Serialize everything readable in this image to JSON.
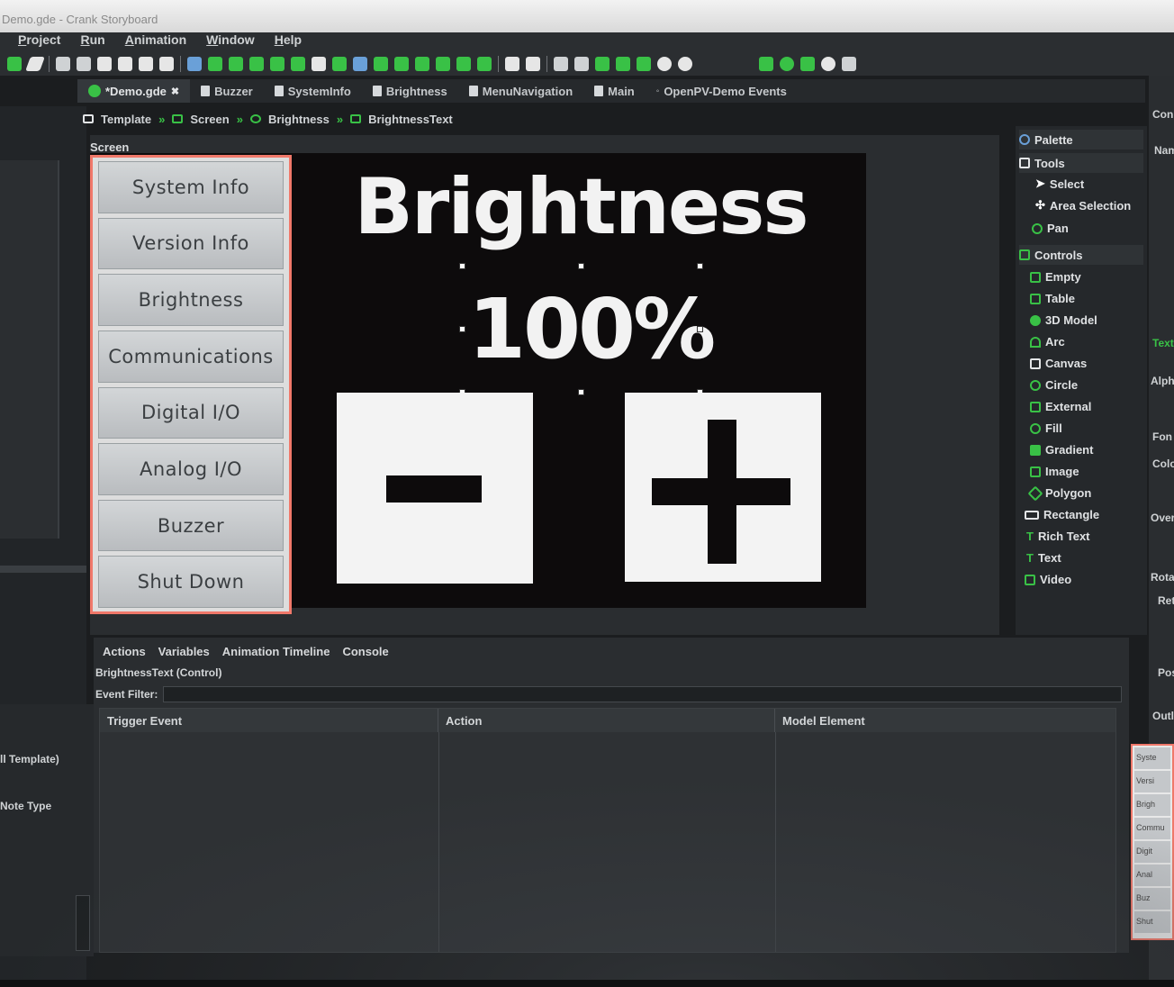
{
  "window_title": "Demo.gde - Crank Storyboard",
  "menu": [
    "Project",
    "Run",
    "Animation",
    "Window",
    "Help"
  ],
  "editor_tabs": [
    {
      "label": "*Demo.gde",
      "active": true
    },
    {
      "label": "Buzzer"
    },
    {
      "label": "SystemInfo"
    },
    {
      "label": "Brightness"
    },
    {
      "label": "MenuNavigation"
    },
    {
      "label": "Main"
    },
    {
      "label": "OpenPV-Demo Events"
    }
  ],
  "breadcrumb": [
    "Template",
    "Screen",
    "Brightness",
    "BrightnessText"
  ],
  "screen_label": "Screen",
  "menu_buttons": [
    "System Info",
    "Version Info",
    "Brightness",
    "Communications",
    "Digital I/O",
    "Analog I/O",
    "Buzzer",
    "Shut Down"
  ],
  "stage": {
    "title": "Brightness",
    "value": "100%"
  },
  "palette": {
    "header": "Palette",
    "tools_header": "Tools",
    "tools": [
      "Select",
      "Area Selection",
      "Pan"
    ],
    "controls_header": "Controls",
    "controls": [
      "Empty",
      "Table",
      "3D Model",
      "Arc",
      "Canvas",
      "Circle",
      "External",
      "Fill",
      "Gradient",
      "Image",
      "Polygon",
      "Rectangle",
      "Rich Text",
      "Text",
      "Video"
    ]
  },
  "bottom_tabs": [
    "Actions",
    "Variables",
    "Animation Timeline",
    "Console"
  ],
  "control_label": "BrightnessText (Control)",
  "event_filter_label": "Event Filter:",
  "table_headers": [
    "Trigger Event",
    "Action",
    "Model Element"
  ],
  "left_panel": {
    "template_label": "ll Template)",
    "note_type": "Note Type"
  },
  "right_strip_labels": [
    "Con",
    "Nam",
    "Text",
    "Alph",
    "Fon",
    "Colo",
    "Over",
    "Rota",
    "Ret",
    "Pos",
    "Outl"
  ],
  "mini_preview_items": [
    "Syste",
    "Versi",
    "Brigh",
    "Commu",
    "Digit",
    "Anal",
    "Buz",
    "Shut"
  ],
  "colors": {
    "accent_green": "#39c146",
    "selection_red": "#f0786a",
    "stage_bg": "#0d0b0c"
  }
}
